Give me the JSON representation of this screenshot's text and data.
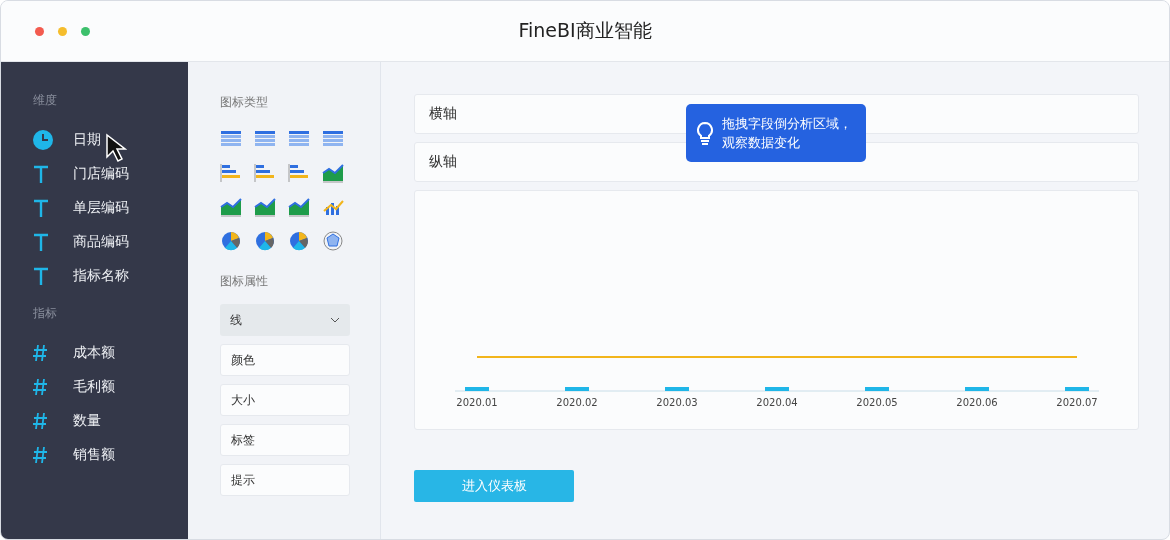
{
  "window": {
    "title": "FineBI商业智能"
  },
  "sidebar": {
    "groups": [
      {
        "heading": "维度",
        "items": [
          {
            "kind": "date",
            "label": "日期"
          },
          {
            "kind": "text",
            "label": "门店编码"
          },
          {
            "kind": "text",
            "label": "单层编码"
          },
          {
            "kind": "text",
            "label": "商品编码"
          },
          {
            "kind": "text",
            "label": "指标名称"
          }
        ]
      },
      {
        "heading": "指标",
        "items": [
          {
            "kind": "number",
            "label": "成本额"
          },
          {
            "kind": "number",
            "label": "毛利额"
          },
          {
            "kind": "number",
            "label": "数量"
          },
          {
            "kind": "number",
            "label": "销售额"
          }
        ]
      }
    ]
  },
  "panel": {
    "chart_types_heading": "图标类型",
    "properties_heading": "图标属性",
    "dropdown": {
      "value": "线"
    },
    "properties": [
      "颜色",
      "大小",
      "标签",
      "提示"
    ]
  },
  "main": {
    "x_axis_label": "横轴",
    "y_axis_label": "纵轴",
    "tooltip": "拖拽字段倒分析区域，观察数据变化",
    "chart_x_labels": [
      "2020.01",
      "2020.02",
      "2020.03",
      "2020.04",
      "2020.05",
      "2020.06",
      "2020.07"
    ],
    "enter_button": "进入仪表板"
  }
}
